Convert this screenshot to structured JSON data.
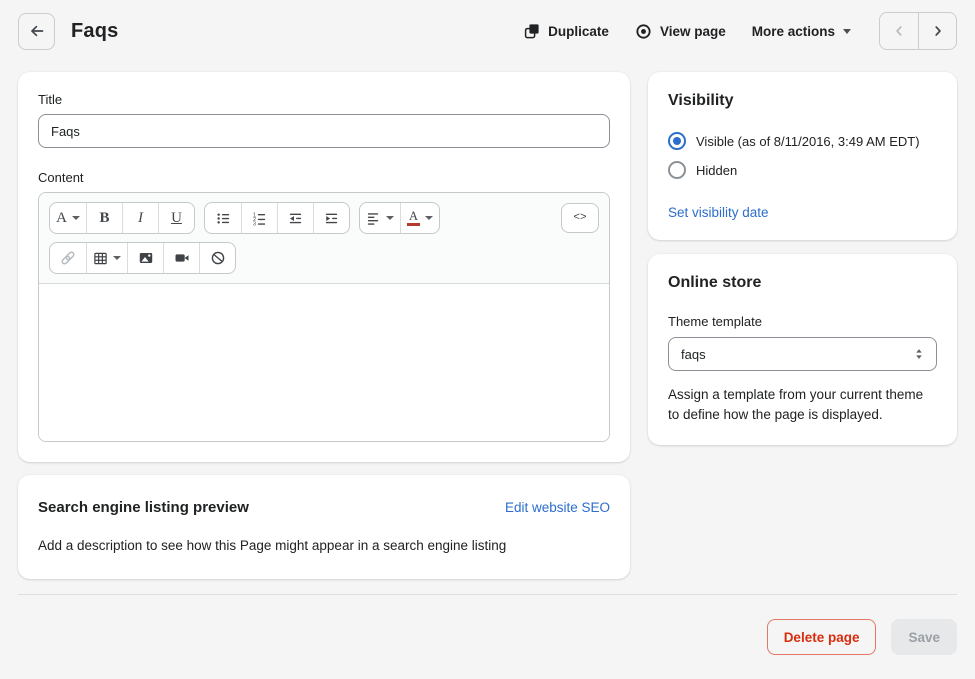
{
  "header": {
    "title": "Faqs",
    "duplicate_label": "Duplicate",
    "view_page_label": "View page",
    "more_actions_label": "More actions"
  },
  "form": {
    "title_label": "Title",
    "title_value": "Faqs",
    "content_label": "Content",
    "toolbar": {
      "font_letter": "A",
      "bold_letter": "B",
      "italic_letter": "I",
      "underline_letter": "U",
      "color_letter": "A",
      "code_glyph": "<>"
    }
  },
  "seo_card": {
    "title": "Search engine listing preview",
    "edit_link": "Edit website SEO",
    "description": "Add a description to see how this Page might appear in a search engine listing"
  },
  "visibility_card": {
    "title": "Visibility",
    "options": [
      {
        "label": "Visible (as of 8/11/2016, 3:49 AM EDT)",
        "selected": true
      },
      {
        "label": "Hidden",
        "selected": false
      }
    ],
    "set_date_link": "Set visibility date"
  },
  "online_store_card": {
    "title": "Online store",
    "template_label": "Theme template",
    "template_value": "faqs",
    "help_text": "Assign a template from your current theme to define how the page is displayed."
  },
  "footer": {
    "delete_label": "Delete page",
    "save_label": "Save"
  },
  "icons": {
    "header": [
      "arrow-left-icon",
      "duplicate-icon",
      "eye-icon",
      "caret-down-icon",
      "chevron-left-icon",
      "chevron-right-icon"
    ],
    "toolbar": [
      "font-style-icon",
      "bold-icon",
      "italic-icon",
      "underline-icon",
      "bullet-list-icon",
      "numbered-list-icon",
      "outdent-icon",
      "indent-icon",
      "align-left-icon",
      "text-color-icon",
      "code-icon",
      "link-icon",
      "table-icon",
      "image-icon",
      "video-icon",
      "clear-formatting-icon"
    ],
    "other": [
      "radio-selected-icon",
      "radio-unselected-icon",
      "select-updown-icon"
    ]
  },
  "colors": {
    "background": "#f5f5f6",
    "text": "#202223",
    "link_blue": "#2c6ecb",
    "radio_blue": "#2c6ecb",
    "destructive_red": "#d82c0d"
  }
}
